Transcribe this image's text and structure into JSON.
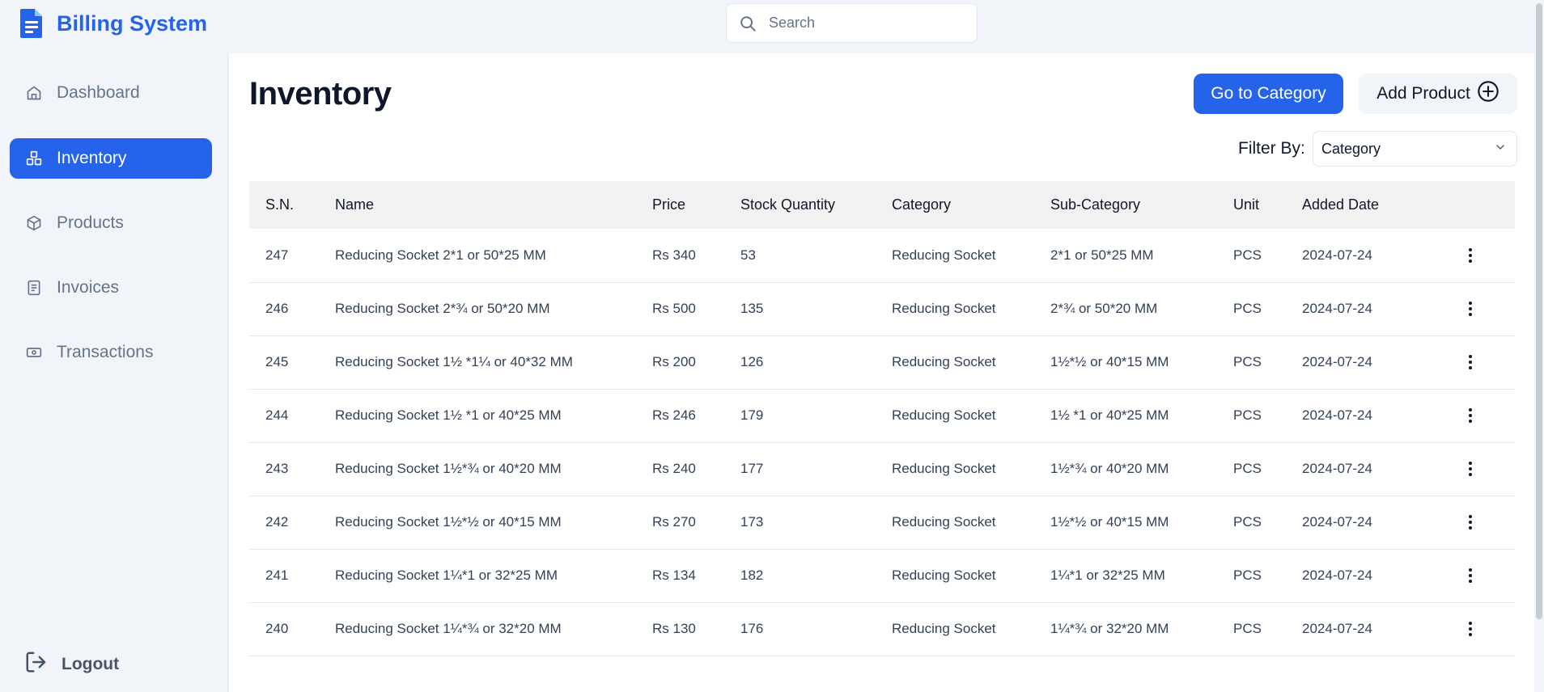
{
  "app": {
    "title": "Billing System",
    "accent": "#2563eb"
  },
  "search": {
    "placeholder": "Search"
  },
  "sidebar": {
    "items": [
      {
        "label": "Dashboard",
        "icon": "home-icon"
      },
      {
        "label": "Inventory",
        "icon": "inventory-icon",
        "active": true
      },
      {
        "label": "Products",
        "icon": "package-icon"
      },
      {
        "label": "Invoices",
        "icon": "document-icon"
      },
      {
        "label": "Transactions",
        "icon": "cash-icon"
      }
    ],
    "logout_label": "Logout"
  },
  "main": {
    "title": "Inventory",
    "go_to_category_label": "Go to Category",
    "add_product_label": "Add Product",
    "filter_label": "Filter By:",
    "filter_value": "Category"
  },
  "table": {
    "headers": [
      "S.N.",
      "Name",
      "Price",
      "Stock Quantity",
      "Category",
      "Sub-Category",
      "Unit",
      "Added Date"
    ],
    "rows": [
      {
        "sn": "247",
        "name": "Reducing Socket 2*1 or 50*25 MM",
        "price": "Rs 340",
        "stock": "53",
        "category": "Reducing Socket",
        "sub": "2*1 or 50*25 MM",
        "unit": "PCS",
        "date": "2024-07-24"
      },
      {
        "sn": "246",
        "name": "Reducing Socket 2*¾ or 50*20 MM",
        "price": "Rs 500",
        "stock": "135",
        "category": "Reducing Socket",
        "sub": "2*¾ or 50*20 MM",
        "unit": "PCS",
        "date": "2024-07-24"
      },
      {
        "sn": "245",
        "name": "Reducing Socket 1½ *1¼ or 40*32 MM",
        "price": "Rs 200",
        "stock": "126",
        "category": "Reducing Socket",
        "sub": "1½*½ or 40*15 MM",
        "unit": "PCS",
        "date": "2024-07-24"
      },
      {
        "sn": "244",
        "name": "Reducing Socket 1½ *1 or 40*25 MM",
        "price": "Rs 246",
        "stock": "179",
        "category": "Reducing Socket",
        "sub": "1½ *1 or 40*25 MM",
        "unit": "PCS",
        "date": "2024-07-24"
      },
      {
        "sn": "243",
        "name": "Reducing Socket 1½*¾ or 40*20 MM",
        "price": "Rs 240",
        "stock": "177",
        "category": "Reducing Socket",
        "sub": "1½*¾ or 40*20 MM",
        "unit": "PCS",
        "date": "2024-07-24"
      },
      {
        "sn": "242",
        "name": "Reducing Socket 1½*½ or 40*15 MM",
        "price": "Rs 270",
        "stock": "173",
        "category": "Reducing Socket",
        "sub": "1½*½ or 40*15 MM",
        "unit": "PCS",
        "date": "2024-07-24"
      },
      {
        "sn": "241",
        "name": "Reducing Socket 1¼*1 or 32*25 MM",
        "price": "Rs 134",
        "stock": "182",
        "category": "Reducing Socket",
        "sub": "1¼*1 or 32*25 MM",
        "unit": "PCS",
        "date": "2024-07-24"
      },
      {
        "sn": "240",
        "name": "Reducing Socket 1¼*¾ or 32*20 MM",
        "price": "Rs 130",
        "stock": "176",
        "category": "Reducing Socket",
        "sub": "1¼*¾ or 32*20 MM",
        "unit": "PCS",
        "date": "2024-07-24"
      }
    ]
  }
}
